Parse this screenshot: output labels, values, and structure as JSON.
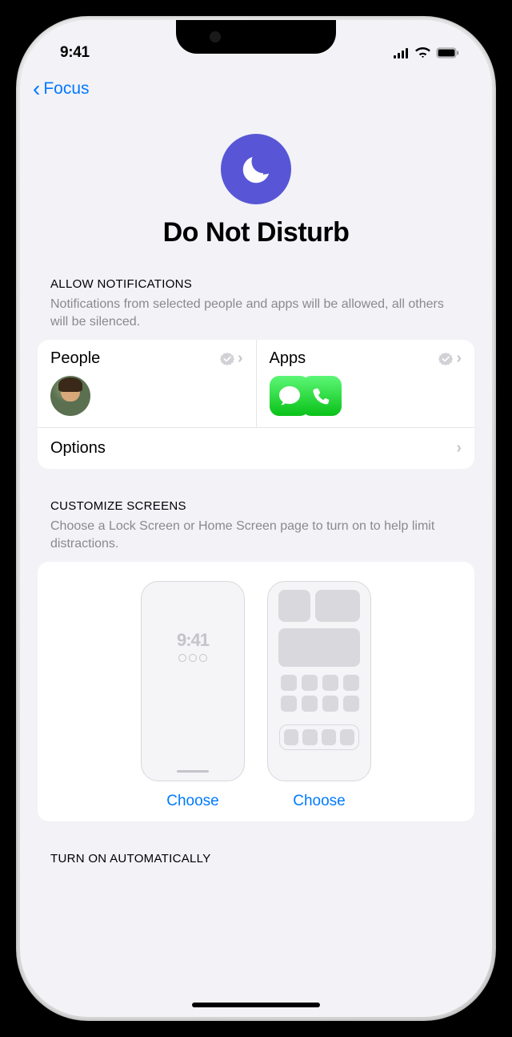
{
  "status": {
    "time": "9:41"
  },
  "nav": {
    "back_label": "Focus"
  },
  "hero": {
    "title": "Do Not Disturb"
  },
  "notifications": {
    "header": "ALLOW NOTIFICATIONS",
    "description": "Notifications from selected people and apps will be allowed, all others will be silenced.",
    "people_label": "People",
    "apps_label": "Apps",
    "options_label": "Options"
  },
  "customize": {
    "header": "CUSTOMIZE SCREENS",
    "description": "Choose a Lock Screen or Home Screen page to turn on to help limit distractions.",
    "lock_time": "9:41",
    "choose_lock": "Choose",
    "choose_home": "Choose"
  },
  "automatic": {
    "header": "TURN ON AUTOMATICALLY"
  }
}
